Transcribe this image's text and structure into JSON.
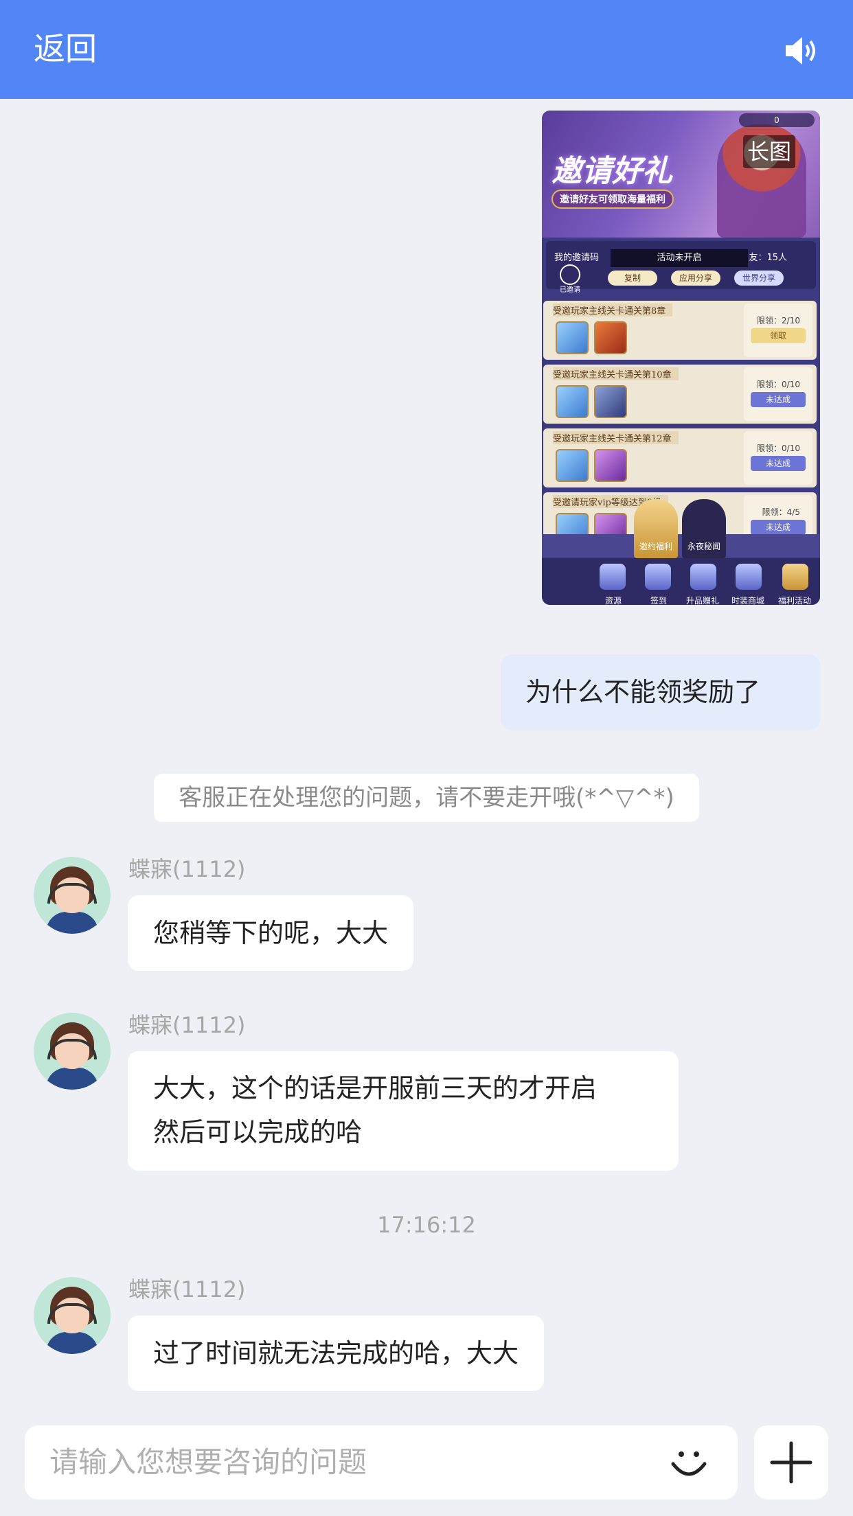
{
  "header": {
    "back_label": "返回",
    "speaker_icon": "speaker-icon"
  },
  "shot": {
    "long_image_label": "长图",
    "coin_count": "0",
    "title": "邀请好礼",
    "subtitle": "邀请好友可领取海量福利",
    "code_label": "我的邀请码",
    "code_notice": "活动未开启",
    "friends_label": "友：15人",
    "invited_label": "已邀请",
    "copy": "复制",
    "app_share": "应用分享",
    "world_share": "世界分享",
    "tasks": [
      {
        "title": "受邀玩家主线关卡通关第8章",
        "limit": "限领：2/10",
        "status": "领取"
      },
      {
        "title": "受邀玩家主线关卡通关第10章",
        "limit": "限领：0/10",
        "status": "未达成"
      },
      {
        "title": "受邀玩家主线关卡通关第12章",
        "limit": "限领：0/10",
        "status": "未达成"
      },
      {
        "title": "受邀请玩家vip等级达到8级",
        "limit": "限领：4/5",
        "status": "未达成"
      }
    ],
    "tab_invite": "邀约福利",
    "tab_night": "永夜秘闻",
    "nav": [
      "资源",
      "签到",
      "升品赠礼",
      "时装商城",
      "福利活动"
    ]
  },
  "chat": {
    "user_msg": "为什么不能领奖励了",
    "system_msg": "客服正在处理您的问题，请不要走开哦(*^▽^*)",
    "agent_name": "蝶寐(1112)",
    "msg1": "您稍等下的呢，大大",
    "msg2_line1": "大大，这个的话是开服前三天的才开启",
    "msg2_line2": "然后可以完成的哈",
    "timestamp": "17:16:12",
    "msg3": "过了时间就无法完成的哈，大大"
  },
  "input": {
    "placeholder": "请输入您想要咨询的问题"
  },
  "colors": {
    "header": "#5286f7",
    "background": "#eff0f5",
    "user_bubble": "#e4ecfc"
  }
}
